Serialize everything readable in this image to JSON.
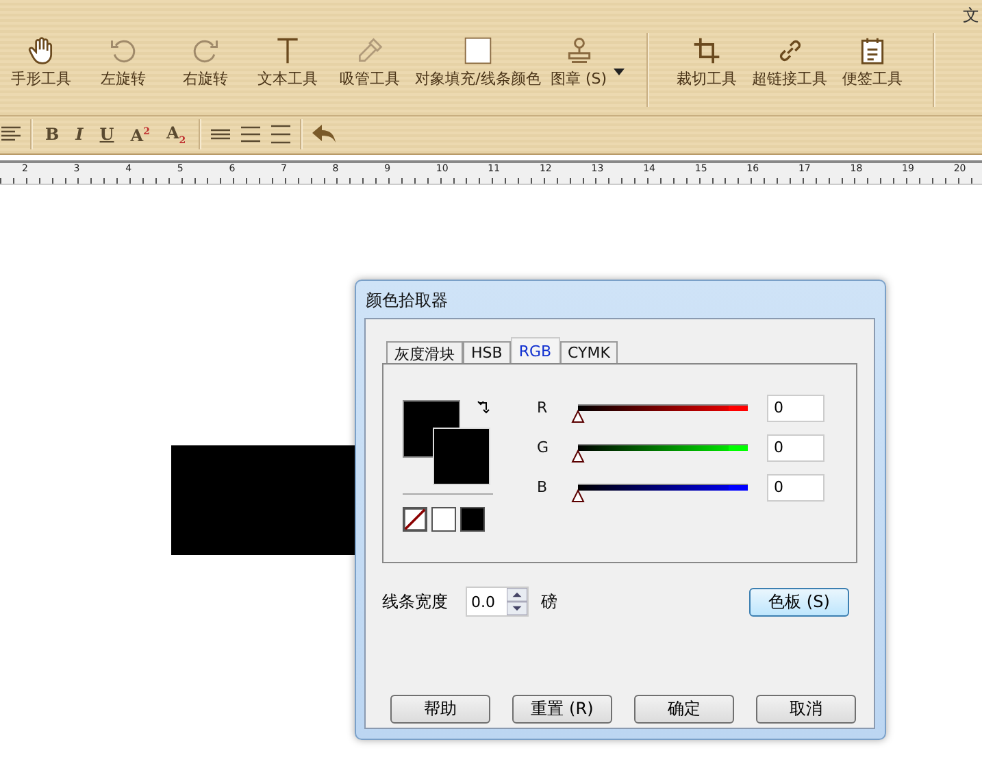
{
  "app_title": "文",
  "toolbar": [
    {
      "kind": "hand",
      "label": "手形工具"
    },
    {
      "kind": "rotate-left",
      "label": "左旋转"
    },
    {
      "kind": "rotate-right",
      "label": "右旋转"
    },
    {
      "kind": "text",
      "label": "文本工具"
    },
    {
      "kind": "eyedropper",
      "label": "吸管工具"
    },
    {
      "kind": "fill",
      "label": "对象填充/线条颜色"
    },
    {
      "kind": "stamp",
      "label": "图章 (S)"
    },
    {
      "kind": "crop",
      "label": "裁切工具"
    },
    {
      "kind": "link",
      "label": "超链接工具"
    },
    {
      "kind": "note",
      "label": "便签工具"
    }
  ],
  "format_buttons": [
    "B",
    "I",
    "U",
    "A$^{2}$",
    "A$_{2}$"
  ],
  "ruler_labels": [
    "2",
    "3",
    "4",
    "5",
    "6",
    "7",
    "8",
    "9",
    "10",
    "11",
    "12",
    "13",
    "14",
    "15",
    "16",
    "17",
    "18",
    "19",
    "20"
  ],
  "dialog": {
    "title": "颜色拾取器",
    "tabs": [
      {
        "label": "灰度滑块",
        "selected": false
      },
      {
        "label": "HSB",
        "selected": false
      },
      {
        "label": "RGB",
        "selected": true
      },
      {
        "label": "CYMK",
        "selected": false
      }
    ],
    "channels": [
      {
        "name": "R",
        "color": "#ff0000",
        "level": 0,
        "value": "0"
      },
      {
        "name": "G",
        "color": "#00ff00",
        "level": 0,
        "value": "0"
      },
      {
        "name": "B",
        "color": "#0000ff",
        "level": 0,
        "value": "0"
      }
    ],
    "line_width": {
      "label": "线条宽度",
      "value": "0.0",
      "unit": "磅"
    },
    "palette_button": "色板 (S)",
    "buttons": [
      "帮助",
      "重置 (R)",
      "确定",
      "取消"
    ]
  }
}
